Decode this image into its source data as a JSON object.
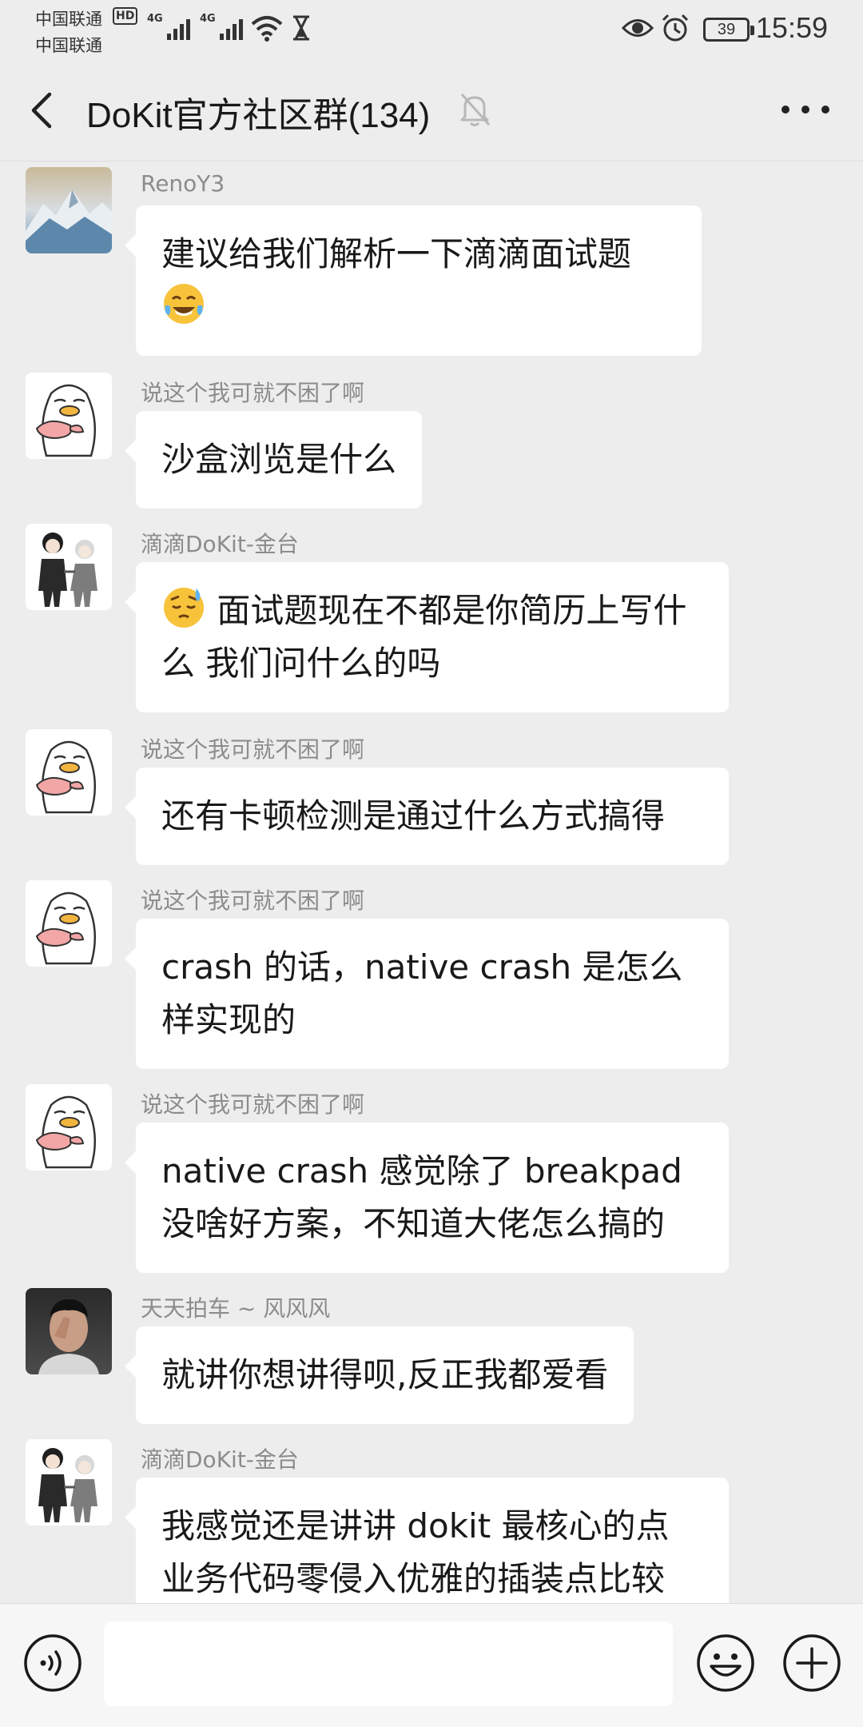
{
  "status_bar": {
    "carrier_1": "中国联通",
    "carrier_2": "中国联通",
    "hd_badge": "HD",
    "network_1": "4G",
    "network_2": "4G",
    "battery": "39",
    "time": "15:59"
  },
  "header": {
    "title": "DoKit官方社区群(134)",
    "back_icon": "chevron-left-icon",
    "mute_icon": "bell-off-icon",
    "more_icon": "more-dots-icon"
  },
  "messages": [
    {
      "sender": "RenoY3",
      "avatar": "mountain-landscape",
      "text": "建议给我们解析一下滴滴面试题",
      "emoji_after": "tears-of-joy-emoji"
    },
    {
      "sender": "说这个我可就不困了啊",
      "avatar": "penguin-sticker",
      "text": "沙盒浏览是什么"
    },
    {
      "sender": "滴滴DoKit-金台",
      "avatar": "two-characters",
      "emoji_before": "relieved-sweat-emoji",
      "text": "面试题现在不都是你简历上写什么  我们问什么的吗"
    },
    {
      "sender": "说这个我可就不困了啊",
      "avatar": "penguin-sticker",
      "text": "还有卡顿检测是通过什么方式搞得"
    },
    {
      "sender": "说这个我可就不困了啊",
      "avatar": "penguin-sticker",
      "text": "crash 的话，native crash 是怎么样实现的"
    },
    {
      "sender": "说这个我可就不困了啊",
      "avatar": "penguin-sticker",
      "text": "native crash 感觉除了 breakpad 没啥好方案，不知道大佬怎么搞的"
    },
    {
      "sender": "天天拍车 ~ 风风风",
      "avatar": "person-photo",
      "text": "就讲你想讲得呗,反正我都爱看"
    },
    {
      "sender": "滴滴DoKit-金台",
      "avatar": "two-characters",
      "text": "我感觉还是讲讲 dokit 最核心的点  业务代码零侵入优雅的插装点比较"
    }
  ],
  "input_bar": {
    "voice_icon": "voice-icon",
    "emoji_icon": "emoji-icon",
    "plus_icon": "plus-icon",
    "input_value": ""
  }
}
